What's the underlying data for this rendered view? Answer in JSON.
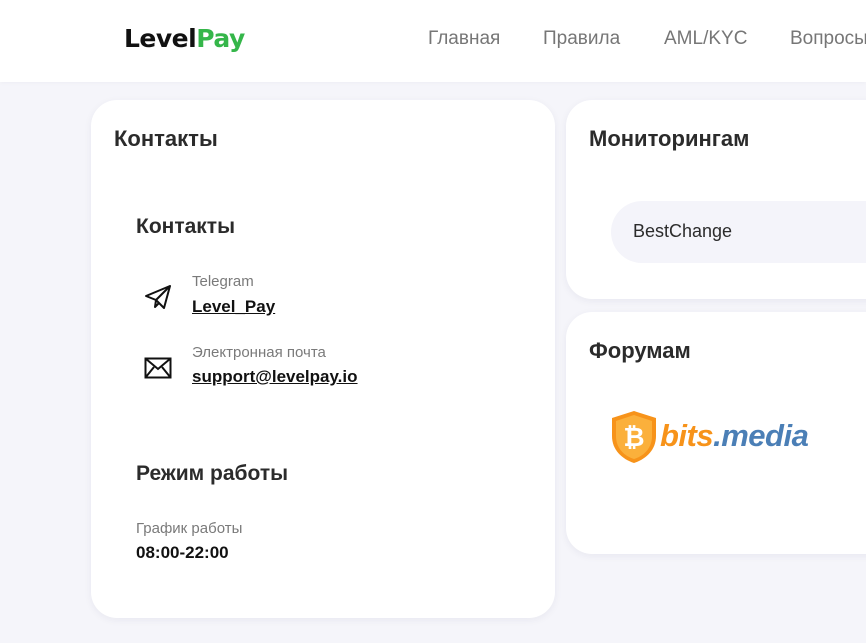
{
  "header": {
    "logo_part1": "Level",
    "logo_part2": "Pay",
    "nav": [
      "Главная",
      "Правила",
      "AML/KYC",
      "Вопросы"
    ]
  },
  "contacts_card": {
    "title": "Контакты",
    "section_contacts_title": "Контакты",
    "telegram_label": "Telegram",
    "telegram_value": "Level_Pay",
    "email_label": "Электронная почта",
    "email_value": "support@levelpay.io",
    "section_hours_title": "Режим работы",
    "schedule_label": "График работы",
    "schedule_value": "08:00-22:00"
  },
  "monitoring_card": {
    "title": "Мониторингам",
    "items": [
      "BestChange"
    ]
  },
  "forums_card": {
    "title": "Форумам",
    "logo_text_1": "bits",
    "logo_text_2": ".media"
  },
  "colors": {
    "brand_green": "#35b64a",
    "bits_orange": "#f7931a",
    "bits_blue": "#4b7fb6"
  }
}
